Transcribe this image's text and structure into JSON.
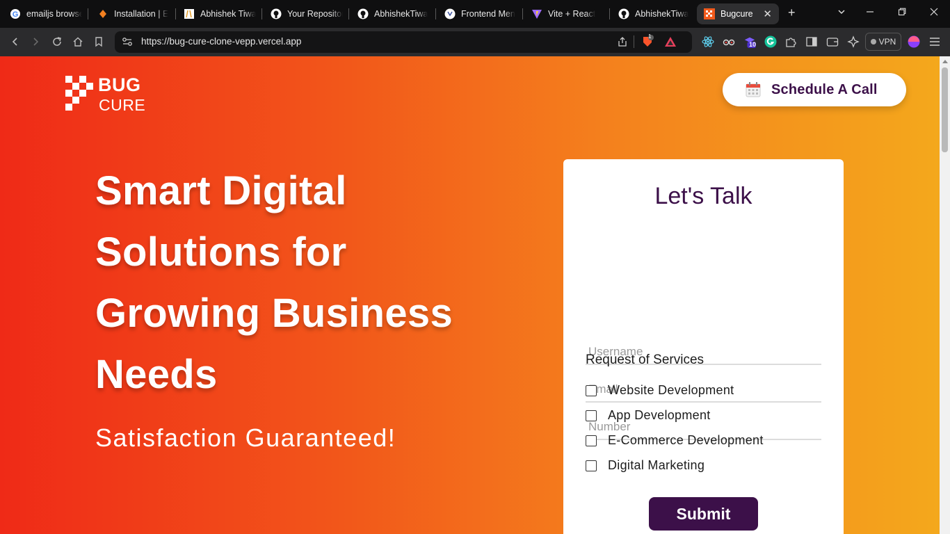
{
  "browser": {
    "tabs": [
      {
        "title": "emailjs browse",
        "icon": "google-icon"
      },
      {
        "title": "Installation | E",
        "icon": "installation-icon"
      },
      {
        "title": "Abhishek Tiwa",
        "icon": "notion-icon"
      },
      {
        "title": "Your Repositor",
        "icon": "github-icon"
      },
      {
        "title": "AbhishekTiwa",
        "icon": "github-icon"
      },
      {
        "title": "Frontend Men",
        "icon": "frontend-mentor-icon"
      },
      {
        "title": "Vite + React",
        "icon": "vite-icon"
      },
      {
        "title": "AbhishekTiwa",
        "icon": "github-icon"
      },
      {
        "title": "Bugcure",
        "icon": "bugcure-icon",
        "active": true
      }
    ],
    "url": "https://bug-cure-clone-vepp.vercel.app",
    "vpn_label": "VPN",
    "brave_badge": "1",
    "extension_badge": "10"
  },
  "page": {
    "logo": {
      "line1": "BUG",
      "line2": "CURE"
    },
    "cta_label": "Schedule A Call",
    "hero": {
      "title_lines": [
        "Smart Digital",
        "Solutions for",
        "Growing Business",
        "Needs"
      ],
      "subtitle": "Satisfaction Guaranteed!"
    },
    "form": {
      "title": "Let's Talk",
      "fields": [
        {
          "placeholder": "Username",
          "value": ""
        },
        {
          "placeholder": "Email",
          "value": ""
        },
        {
          "placeholder": "Number",
          "value": ""
        }
      ],
      "services_title": "Request of Services",
      "services": [
        {
          "label": "Website Development",
          "checked": false
        },
        {
          "label": "App Development",
          "checked": false
        },
        {
          "label": "E-Commerce Development",
          "checked": false
        },
        {
          "label": "Digital Marketing",
          "checked": false
        }
      ],
      "submit_label": "Submit"
    }
  },
  "colors": {
    "gradient_start": "#ef2a17",
    "gradient_end": "#f4a81c",
    "brand_purple": "#3c1049"
  }
}
